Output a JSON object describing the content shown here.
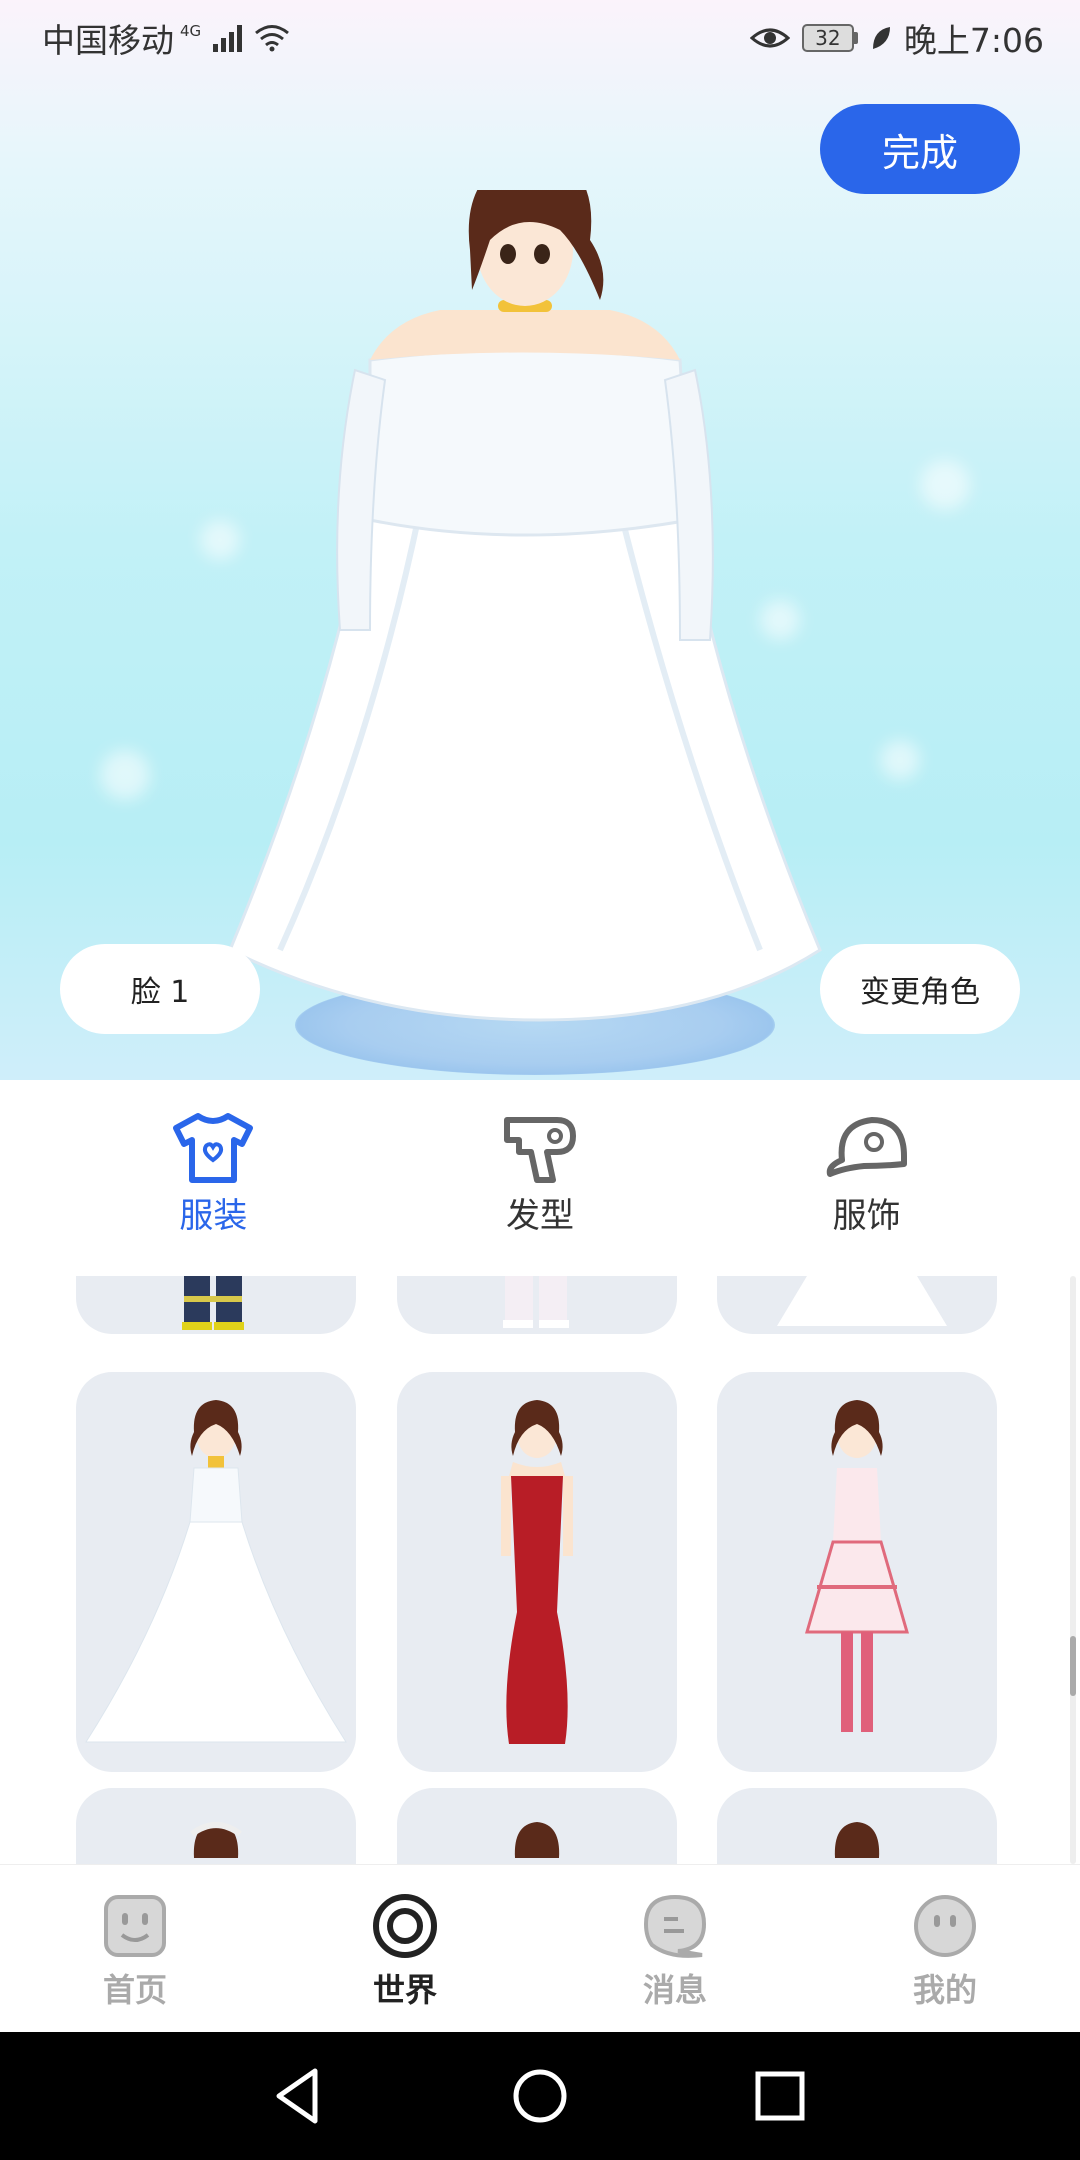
{
  "status_bar": {
    "carrier": "中国移动",
    "network": "4G",
    "battery": "32",
    "time": "晚上7:06"
  },
  "hero": {
    "done_label": "完成",
    "face_label": "脸 1",
    "change_character_label": "变更角色"
  },
  "category_tabs": [
    {
      "label": "服装",
      "icon": "tshirt-icon",
      "active": true
    },
    {
      "label": "发型",
      "icon": "hair-dryer-icon",
      "active": false
    },
    {
      "label": "服饰",
      "icon": "cap-icon",
      "active": false
    }
  ],
  "outfits": [
    {
      "name": "firefighter-uniform",
      "row": "partial-top"
    },
    {
      "name": "white-outfit",
      "row": "partial-top"
    },
    {
      "name": "wedding-dress",
      "row": "partial-top"
    },
    {
      "name": "wedding-dress",
      "row": "full"
    },
    {
      "name": "red-evening-gown",
      "row": "full"
    },
    {
      "name": "pink-lolita-dress",
      "row": "full"
    },
    {
      "name": "outfit-7",
      "row": "partial-bottom"
    },
    {
      "name": "outfit-8",
      "row": "partial-bottom"
    },
    {
      "name": "outfit-9",
      "row": "partial-bottom"
    }
  ],
  "bottom_nav": [
    {
      "label": "首页",
      "icon": "home-face-icon",
      "active": false
    },
    {
      "label": "世界",
      "icon": "world-target-icon",
      "active": true
    },
    {
      "label": "消息",
      "icon": "message-bubble-icon",
      "active": false
    },
    {
      "label": "我的",
      "icon": "profile-face-icon",
      "active": false
    }
  ],
  "colors": {
    "accent": "#2a66ea",
    "card_bg": "#e8ecf2",
    "inactive": "#aaaaaa"
  }
}
